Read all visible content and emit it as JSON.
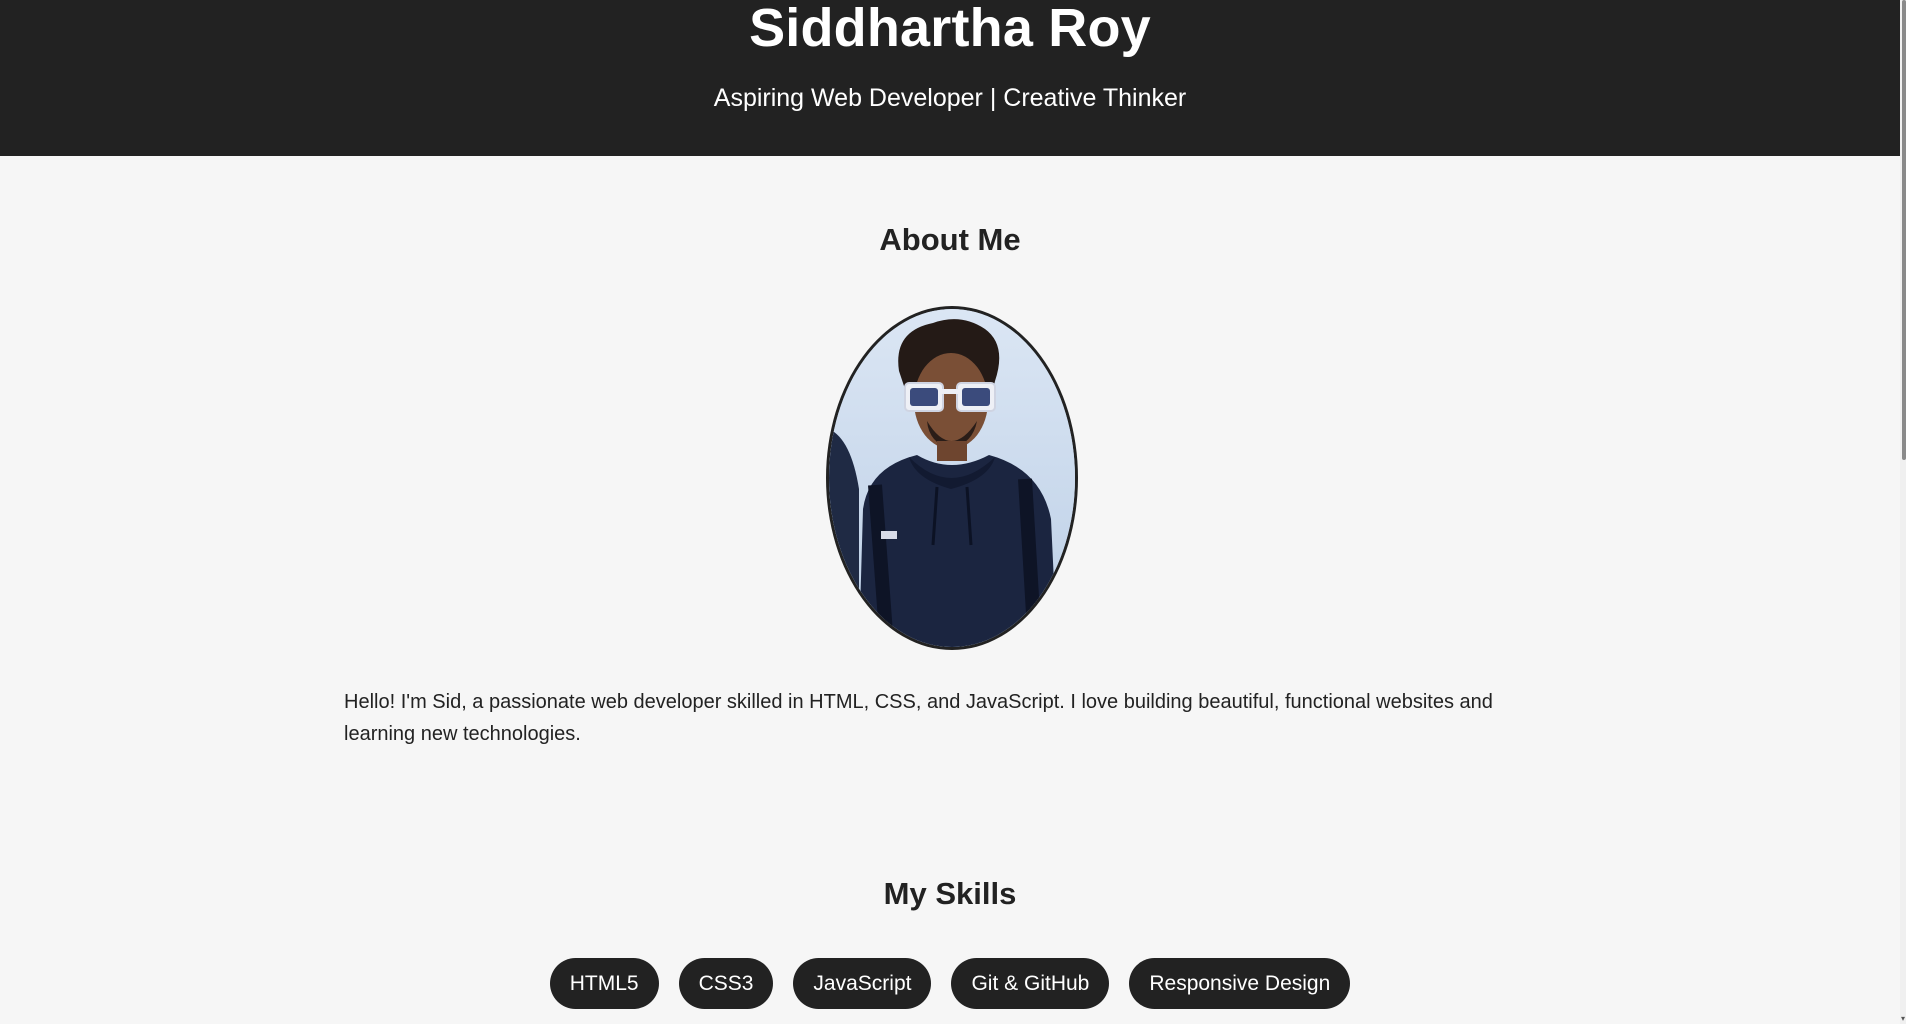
{
  "header": {
    "name": "Siddhartha Roy",
    "tagline": "Aspiring Web Developer | Creative Thinker"
  },
  "about": {
    "heading": "About Me",
    "bio": "Hello! I'm Sid, a passionate web developer skilled in HTML, CSS, and JavaScript. I love building beautiful, functional websites and learning new technologies."
  },
  "skills": {
    "heading": "My Skills",
    "items": [
      "HTML5",
      "CSS3",
      "JavaScript",
      "Git & GitHub",
      "Responsive Design"
    ]
  },
  "colors": {
    "header_bg": "#222222",
    "page_bg": "#f6f6f6",
    "pill_bg": "#222222",
    "pill_text": "#ffffff"
  }
}
